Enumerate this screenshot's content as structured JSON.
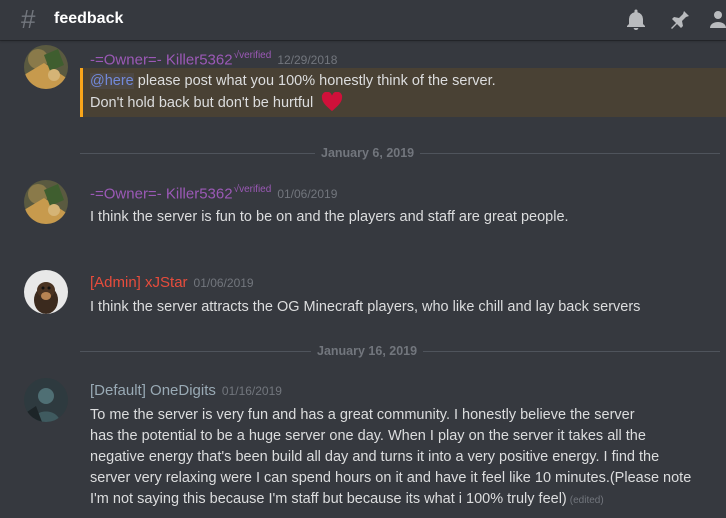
{
  "channel": {
    "name": "feedback",
    "icons": [
      "bell-icon",
      "pin-icon",
      "members-icon"
    ]
  },
  "dividers": [
    "January 6, 2019",
    "January 16, 2019"
  ],
  "messages": [
    {
      "author": "-=Owner=- Killer5362",
      "verified": "√verified",
      "timestamp": "12/29/2018",
      "name_color": "#9b59b6",
      "mention": "@here",
      "text_line1": " please post what you 100% honestly think of the server.",
      "text_line2": "Don't hold back but don't be hurtful",
      "emoji": "heart-emoji"
    },
    {
      "author": "-=Owner=- Killer5362",
      "verified": "√verified",
      "timestamp": "01/06/2019",
      "name_color": "#9b59b6",
      "text": "I think the server is fun to be on and the players and staff are great people."
    },
    {
      "author": "[Admin] xJStar",
      "timestamp": "01/06/2019",
      "name_color": "#e74c3c",
      "text": "I think the server attracts the OG Minecraft players, who like chill and lay back servers"
    },
    {
      "author": "[Default] OneDigits",
      "timestamp": "01/16/2019",
      "name_color": "#99aab5",
      "lines": [
        "To me the server is very fun and has a great community. I honestly believe the server",
        "has the potential to be a huge server one day. When I play on  the server it takes all the",
        "negative energy that's been build all day and turns it into a very positive energy. I find the",
        "server very relaxing were I can spend hours on it and have it feel like 10 minutes.(Please note",
        "I'm not saying this because I'm staff but because its what i 100% truly feel)"
      ],
      "edited": "(edited)"
    }
  ],
  "colors": {
    "background": "#36393f",
    "mention_highlight": "#494134",
    "mention_bar": "#faa61a",
    "timestamp": "#72767d"
  }
}
